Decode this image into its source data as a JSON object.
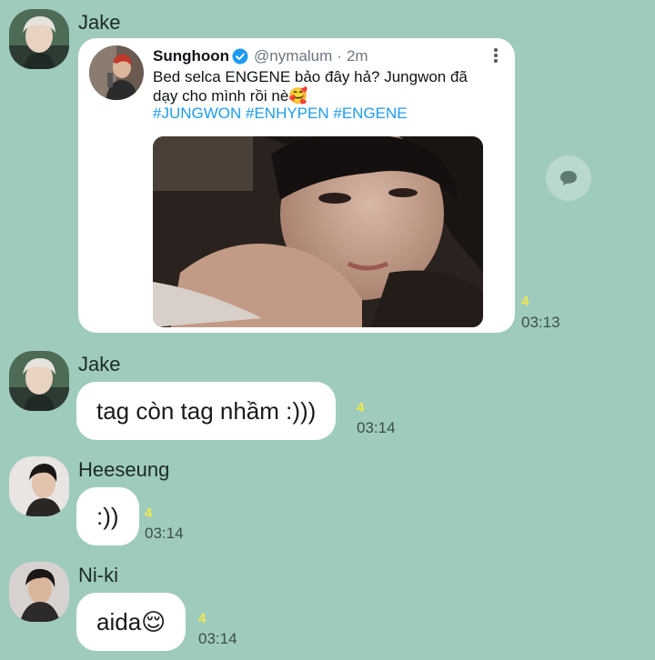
{
  "messages": [
    {
      "sender": "Jake",
      "type": "tweet",
      "tweet": {
        "author": "Sunghoon",
        "handle": "@nymalum",
        "separator": "·",
        "age": "2m",
        "text_line1": "Bed selca ENGENE bảo đây hả? Jungwon đã",
        "text_line2": "dạy cho mình rồi nè🥰",
        "hashtags": "#JUNGWON #ENHYPEN #ENGENE"
      },
      "unread": "4",
      "time": "03:13"
    },
    {
      "sender": "Jake",
      "text": "tag còn tag nhầm :)))",
      "unread": "4",
      "time": "03:14"
    },
    {
      "sender": "Heeseung",
      "text": ":))",
      "unread": "4",
      "time": "03:14"
    },
    {
      "sender": "Ni-ki",
      "text": "aida😌",
      "unread": "4",
      "time": "03:14"
    }
  ],
  "colors": {
    "background": "#9fcbbd",
    "unread": "#f2e84a",
    "hashtag": "#1d9bf0",
    "verified": "#1d9bf0"
  },
  "icons": {
    "verified": "verified-badge-icon",
    "more": "more-vertical-icon",
    "share": "share-chat-icon"
  }
}
